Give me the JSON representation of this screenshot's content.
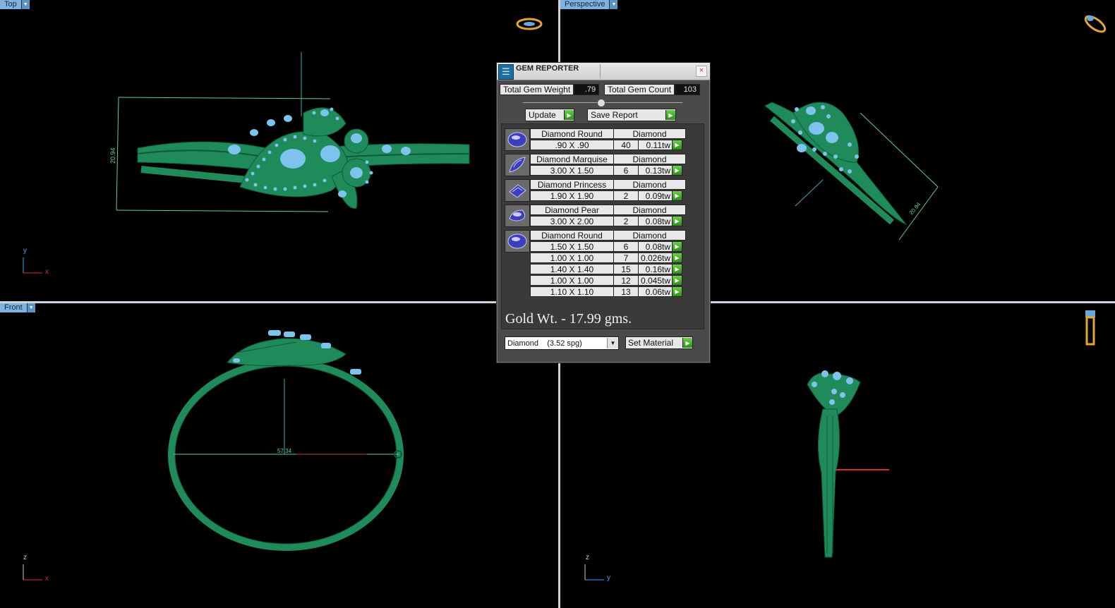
{
  "viewports": {
    "top": {
      "label": "Top",
      "dimension": "20.94"
    },
    "perspective": {
      "label": "Perspective",
      "dimension": "20.94"
    },
    "front": {
      "label": "Front",
      "dimension": "57.34"
    },
    "right": {
      "label": ""
    }
  },
  "axes": {
    "x": "x",
    "y": "y",
    "z": "z"
  },
  "gem_reporter": {
    "title": "GEM REPORTER",
    "close": "×",
    "total_weight_label": "Total Gem Weight",
    "total_weight_value": ".79",
    "total_count_label": "Total Gem Count",
    "total_count_value": "103",
    "update_label": "Update",
    "save_label": "Save Report",
    "groups": [
      {
        "name": "Diamond Round",
        "material": "Diamond",
        "icon": "round-gem-icon",
        "rows": [
          {
            "size": ".90 X .90",
            "count": "40",
            "tw": "0.11tw"
          }
        ]
      },
      {
        "name": "Diamond Marquise",
        "material": "Diamond",
        "icon": "marquise-gem-icon",
        "rows": [
          {
            "size": "3.00 X 1.50",
            "count": "6",
            "tw": "0.13tw"
          }
        ]
      },
      {
        "name": "Diamond Princess",
        "material": "Diamond",
        "icon": "princess-gem-icon",
        "rows": [
          {
            "size": "1.90 X 1.90",
            "count": "2",
            "tw": "0.09tw"
          }
        ]
      },
      {
        "name": "Diamond Pear",
        "material": "Diamond",
        "icon": "pear-gem-icon",
        "rows": [
          {
            "size": "3.00 X 2.00",
            "count": "2",
            "tw": "0.08tw"
          }
        ]
      },
      {
        "name": "Diamond Round",
        "material": "Diamond",
        "icon": "round-gem-icon",
        "rows": [
          {
            "size": "1.50 X 1.50",
            "count": "6",
            "tw": "0.08tw"
          },
          {
            "size": "1.00 X 1.00",
            "count": "7",
            "tw": "0.026tw"
          },
          {
            "size": "1.40 X 1.40",
            "count": "15",
            "tw": "0.16tw"
          },
          {
            "size": "1.00 X 1.00",
            "count": "12",
            "tw": "0.045tw"
          },
          {
            "size": "1.10 X 1.10",
            "count": "13",
            "tw": "0.06tw"
          }
        ]
      }
    ],
    "gold_weight": "Gold Wt. - 17.99 gms.",
    "material_select": "Diamond    (3.52 spg)",
    "set_material_label": "Set Material"
  },
  "colors": {
    "model": "#1f8a5a",
    "gem": "#7ec3ec",
    "dim_line": "#5fd19b",
    "axis_x": "#d03030"
  }
}
